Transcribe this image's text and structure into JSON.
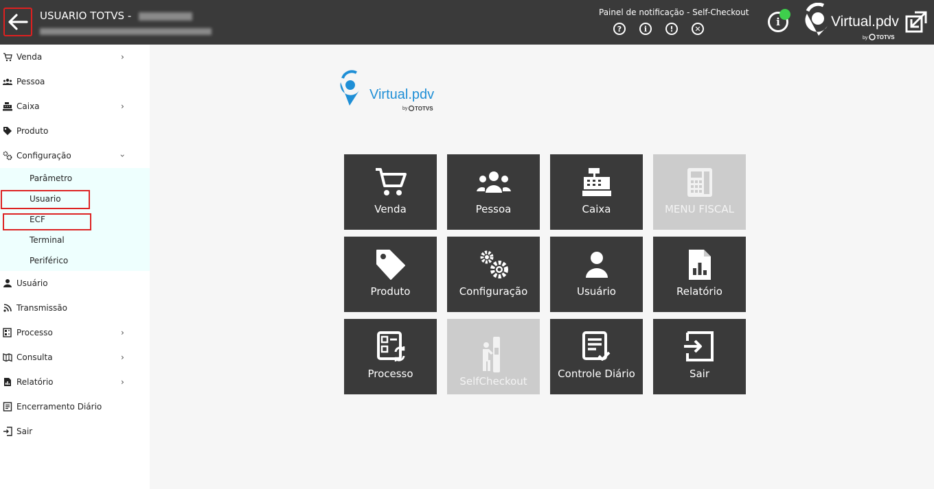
{
  "header": {
    "user_title": "USUARIO TOTVS - ",
    "notification_title": "Painel de notificação - Self-Checkout",
    "notification_icons": [
      "help-icon",
      "info-icon",
      "alert-icon",
      "close-icon"
    ],
    "info_status": "online",
    "brand_logo_text": "Virtual.pdv",
    "brand_by": "by",
    "brand_totvs": "TOTVS"
  },
  "sidebar": {
    "items": [
      {
        "label": "Venda",
        "icon": "cart-icon",
        "has_submenu": true
      },
      {
        "label": "Pessoa",
        "icon": "people-icon",
        "has_submenu": false
      },
      {
        "label": "Caixa",
        "icon": "cash-register-icon",
        "has_submenu": true
      },
      {
        "label": "Produto",
        "icon": "tag-icon",
        "has_submenu": false
      },
      {
        "label": "Configuração",
        "icon": "gears-icon",
        "has_submenu": true,
        "expanded": true
      },
      {
        "label": "Usuário",
        "icon": "user-icon",
        "has_submenu": false
      },
      {
        "label": "Transmissão",
        "icon": "broadcast-icon",
        "has_submenu": false
      },
      {
        "label": "Processo",
        "icon": "process-icon",
        "has_submenu": true
      },
      {
        "label": "Consulta",
        "icon": "map-icon",
        "has_submenu": true
      },
      {
        "label": "Relatório",
        "icon": "report-icon",
        "has_submenu": true
      },
      {
        "label": "Encerramento Diário",
        "icon": "list-icon",
        "has_submenu": false
      },
      {
        "label": "Sair",
        "icon": "exit-icon",
        "has_submenu": false
      }
    ],
    "config_subitems": [
      "Parâmetro",
      "Usuario",
      "ECF",
      "Terminal",
      "Periférico"
    ]
  },
  "main": {
    "logo_text": "Virtual.pdv",
    "logo_by": "by",
    "logo_totvs": "TOTVS",
    "tiles": [
      {
        "label": "Venda",
        "icon": "cart-icon",
        "enabled": true
      },
      {
        "label": "Pessoa",
        "icon": "people-icon",
        "enabled": true
      },
      {
        "label": "Caixa",
        "icon": "cash-register-icon",
        "enabled": true
      },
      {
        "label": "MENU FISCAL",
        "icon": "calculator-icon",
        "enabled": false
      },
      {
        "label": "Produto",
        "icon": "tag-icon",
        "enabled": true
      },
      {
        "label": "Configuração",
        "icon": "gears-icon",
        "enabled": true
      },
      {
        "label": "Usuário",
        "icon": "user-icon",
        "enabled": true
      },
      {
        "label": "Relatório",
        "icon": "report-icon",
        "enabled": true
      },
      {
        "label": "Processo",
        "icon": "process-icon",
        "enabled": true
      },
      {
        "label": "SelfCheckout",
        "icon": "self-checkout-icon",
        "enabled": false
      },
      {
        "label": "Controle Diário",
        "icon": "daily-control-icon",
        "enabled": true
      },
      {
        "label": "Sair",
        "icon": "exit-icon",
        "enabled": true
      }
    ]
  },
  "colors": {
    "header_bg": "#3a3a3a",
    "tile_bg": "#3a3a3a",
    "tile_disabled": "#cccccc",
    "brand_blue": "#1f8fd6",
    "highlight_red": "#dd2222",
    "submenu_bg": "#eefffe",
    "status_green": "#3ecf4c"
  }
}
